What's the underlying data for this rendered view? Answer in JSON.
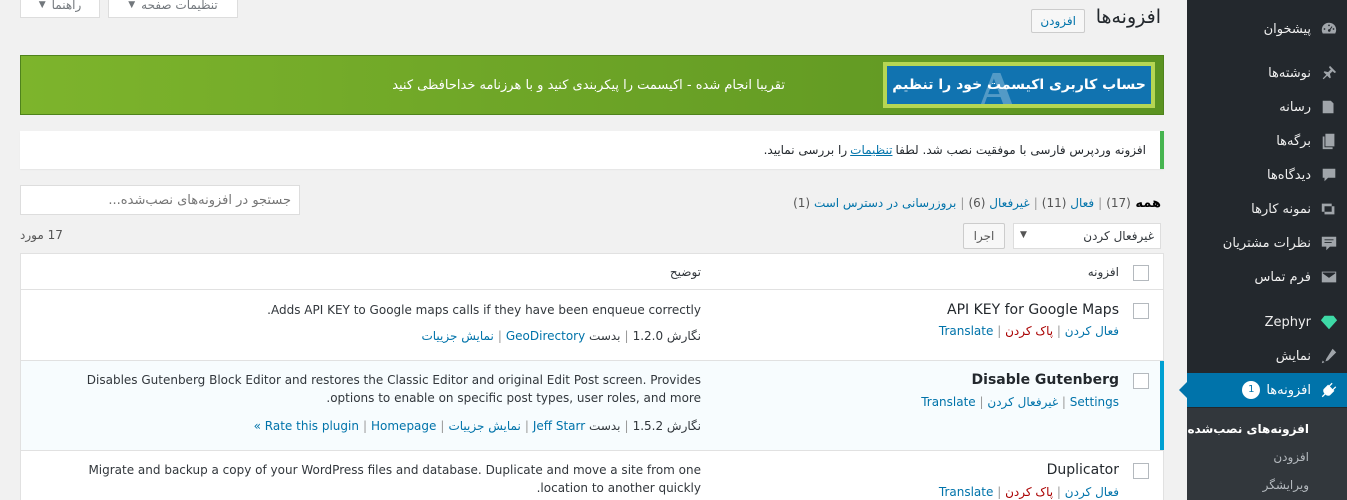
{
  "sidebar": {
    "items": [
      {
        "label": "پیشخوان",
        "icon": "dashboard-icon"
      },
      {
        "label": "نوشته‌ها",
        "icon": "pushpin-icon"
      },
      {
        "label": "رسانه",
        "icon": "media-icon"
      },
      {
        "label": "برگه‌ها",
        "icon": "pages-icon"
      },
      {
        "label": "دیدگاه‌ها",
        "icon": "comments-icon"
      },
      {
        "label": "نمونه کارها",
        "icon": "portfolio-icon"
      },
      {
        "label": "نظرات مشتریان",
        "icon": "testimonials-icon"
      },
      {
        "label": "فرم تماس",
        "icon": "mail-icon"
      },
      {
        "label": "Zephyr",
        "icon": "diamond-icon"
      },
      {
        "label": "نمایش",
        "icon": "appearance-icon"
      },
      {
        "label": "افزونه‌ها",
        "icon": "plugins-icon",
        "badge": "1"
      }
    ],
    "submenu": [
      "افزونه‌های نصب‌شده",
      "افزودن",
      "ویرایشگر"
    ]
  },
  "top_tabs": {
    "help": "راهنما",
    "screen_options": "تنظیمات صفحه"
  },
  "header": {
    "title": "افزونه‌ها",
    "add_new": "افزودن"
  },
  "banner": {
    "button": "حساب کاربری اکیسمت خود را تنظیم",
    "logo": "A",
    "message": "تقریبا انجام شده - اکیسمت را پیکربندی کنید و با هرزنامه خداحافظی کنید"
  },
  "notice": {
    "before": "افزونه وردپرس فارسی با موفقیت نصب شد. لطفا",
    "link": "تنظیمات",
    "after": "را بررسی نمایید."
  },
  "filters": {
    "all": "همه",
    "all_count": "(17)",
    "active": "فعال",
    "active_count": "(11)",
    "inactive": "غیرفعال",
    "inactive_count": "(6)",
    "updates": "بروزرسانی در دسترس است",
    "updates_count": "(1)"
  },
  "search": {
    "placeholder": "جستجو در افزونه‌های نصب‌شده..."
  },
  "bulk": {
    "selected": "غیرفعال کردن",
    "apply": "اجرا"
  },
  "item_count": "17 مورد",
  "table": {
    "col_plugin": "افزونه",
    "col_description": "توضیح",
    "rows": [
      {
        "name": "API KEY for Google Maps",
        "actions": [
          "فعال کردن",
          "پاک کردن",
          "Translate"
        ],
        "description": "Adds API KEY to Google maps calls if they have been enqueue correctly.",
        "version": "نگارش 1.2.0",
        "by": "بدست",
        "author": "GeoDirectory",
        "details": "نمایش جزییات"
      },
      {
        "name": "Disable Gutenberg",
        "actions": [
          "Settings",
          "غیرفعال کردن",
          "Translate"
        ],
        "description": "Disables Gutenberg Block Editor and restores the Classic Editor and original Edit Post screen. Provides options to enable on specific post types, user roles, and more.",
        "version": "نگارش 1.5.2",
        "by": "بدست",
        "author": "Jeff Starr",
        "details": "نمایش جزییات",
        "rate": "Rate this plugin",
        "homepage": "Homepage »"
      },
      {
        "name": "Duplicator",
        "actions": [
          "فعال کردن",
          "پاک کردن",
          "Translate"
        ],
        "description": "Migrate and backup a copy of your WordPress files and database. Duplicate and move a site from one location to another quickly."
      }
    ]
  }
}
